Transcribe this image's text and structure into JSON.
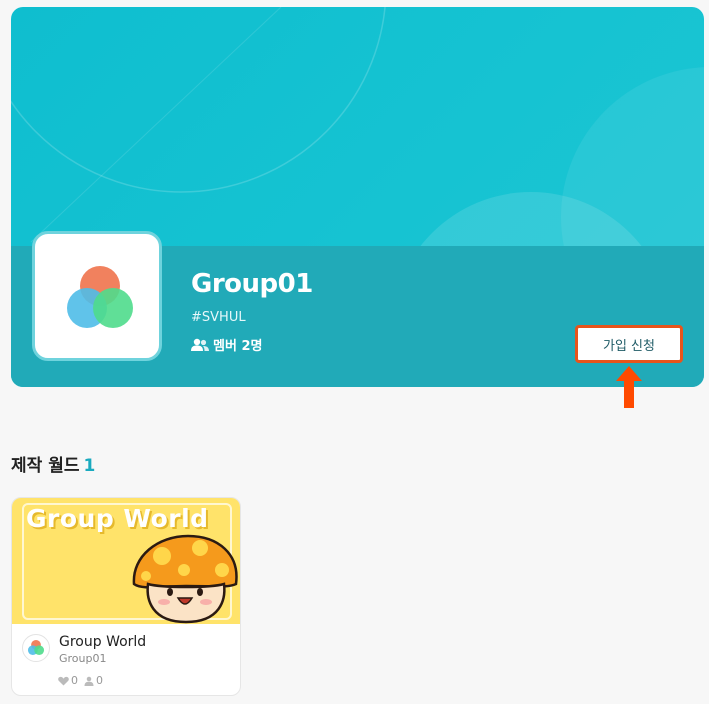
{
  "group": {
    "name": "Group01",
    "tag": "#SVHUL",
    "members_label": "멤버 2명",
    "join_button": "가입 신청"
  },
  "section": {
    "title": "제작 월드",
    "count": "1"
  },
  "worlds": [
    {
      "thumbnail_text": "Group World",
      "title": "Group World",
      "owner": "Group01",
      "likes": "0",
      "players": "0"
    }
  ],
  "colors": {
    "banner": "#13c0d0",
    "info_band": "#21aab8",
    "accent": "#1aaabf",
    "highlight_border": "#e8541b",
    "arrow": "#ff4a00",
    "thumbnail_bg": "#ffe36a"
  },
  "icons": {
    "members": "users-icon",
    "likes": "heart-icon",
    "players": "person-icon",
    "arrow": "up-arrow-icon"
  }
}
